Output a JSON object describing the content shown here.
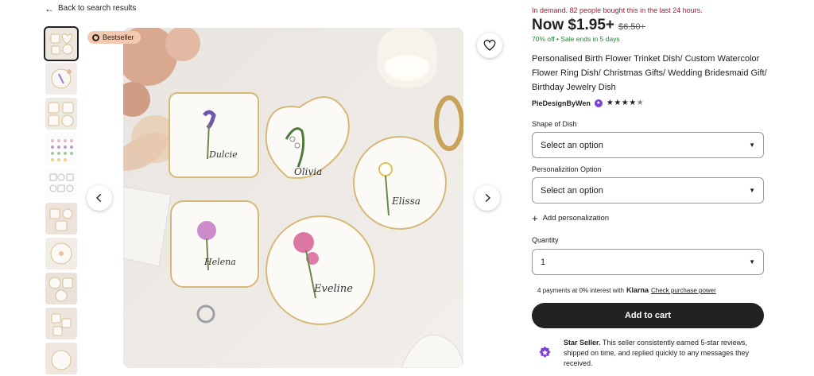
{
  "nav": {
    "back_label": "Back to search results"
  },
  "gallery": {
    "badge_label": "Bestseller",
    "thumbnail_count": 10,
    "names_on_dishes": [
      "Dulcie",
      "Olivia",
      "Elissa",
      "Helena",
      "Eveline"
    ]
  },
  "listing": {
    "demand_text": "In demand. 82 people bought this in the last 24 hours.",
    "price_now": "Now $1.95+",
    "price_original": "$6.50+",
    "discount_text": "70% off",
    "sale_text": "Sale ends in 5 days",
    "title": "Personalised Birth Flower Trinket Dish/ Custom Watercolor Flower Ring Dish/ Christmas Gifts/ Wedding Bridesmaid Gift/ Birthday Jewelry Dish",
    "shop_name": "PieDesignByWen",
    "rating": 4.5
  },
  "form": {
    "shape_label": "Shape of Dish",
    "shape_value": "Select an option",
    "personalization_label": "Personalizition Option",
    "personalization_value": "Select an option",
    "add_personalization_label": "Add personalization",
    "quantity_label": "Quantity",
    "quantity_value": "1"
  },
  "payment": {
    "klarna_prefix": "4 payments at 0% interest with",
    "klarna_brand": "Klarna",
    "klarna_link": "Check purchase power"
  },
  "cart": {
    "add_to_cart_label": "Add to cart"
  },
  "star_seller": {
    "title": "Star Seller.",
    "text": "This seller consistently earned 5-star reviews, shipped on time, and replied quickly to any messages they received."
  },
  "colors": {
    "demand_red": "#a61a2e",
    "sale_green": "#258635",
    "cart_black": "#222222",
    "star_seller_purple": "#7d3fd3",
    "badge_peach": "#f4c9b0"
  },
  "icons": {
    "back": "arrow-left-icon",
    "favorite": "heart-icon",
    "prev": "chevron-left-icon",
    "next": "chevron-right-icon",
    "badge": "award-icon",
    "select": "caret-down-icon",
    "add": "plus-icon",
    "star_seller": "star-seller-icon"
  }
}
